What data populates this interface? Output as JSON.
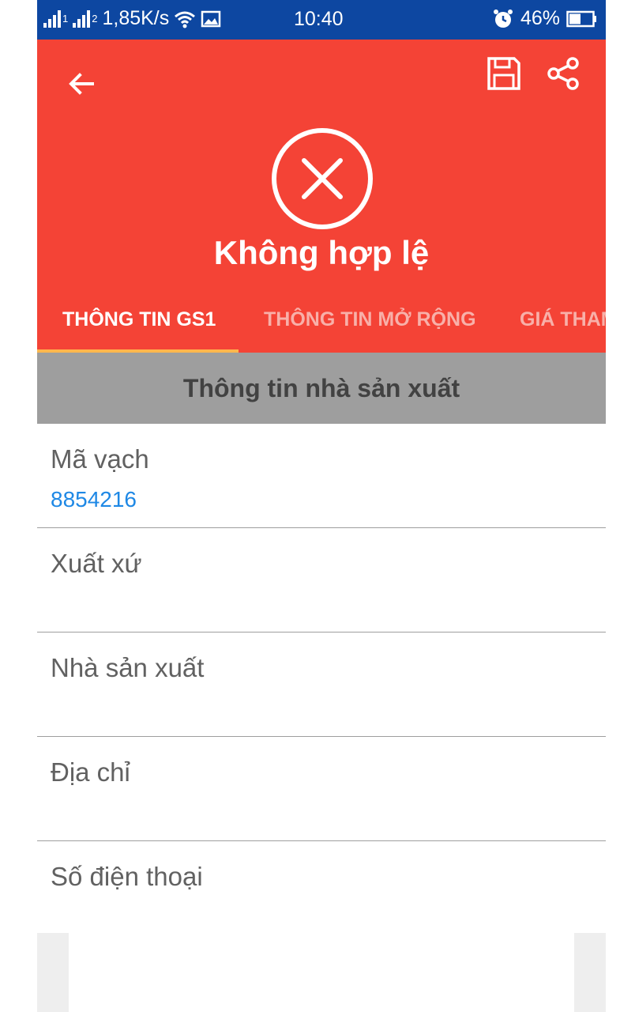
{
  "status_bar": {
    "sim1": "1",
    "sim2": "2",
    "network_speed": "1,85K/s",
    "time": "10:40",
    "battery": "46%",
    "icons": [
      "signal-icon",
      "wifi-icon",
      "image-icon",
      "alarm-icon",
      "battery-icon"
    ]
  },
  "toolbar": {
    "icons": [
      "back-arrow-icon",
      "save-icon",
      "share-icon"
    ]
  },
  "result": {
    "icon": "x-circle-icon",
    "title": "Không hợp lệ"
  },
  "tabs": [
    {
      "label": "THÔNG TIN GS1",
      "active": true
    },
    {
      "label": "THÔNG TIN MỞ RỘNG",
      "active": false
    },
    {
      "label": "GIÁ THAM",
      "active": false
    }
  ],
  "section_title": "Thông tin nhà sản xuất",
  "fields": [
    {
      "label": "Mã vạch",
      "value": "8854216"
    },
    {
      "label": "Xuất xứ",
      "value": ""
    },
    {
      "label": "Nhà sản xuất",
      "value": ""
    },
    {
      "label": "Địa chỉ",
      "value": ""
    },
    {
      "label": "Số điện thoại",
      "value": ""
    }
  ],
  "colors": {
    "status_bar": "#0d47a1",
    "header": "#f44336",
    "tab_indicator": "#ffb74d",
    "section_bg": "#9e9e9e",
    "value_link": "#1e88e5"
  }
}
